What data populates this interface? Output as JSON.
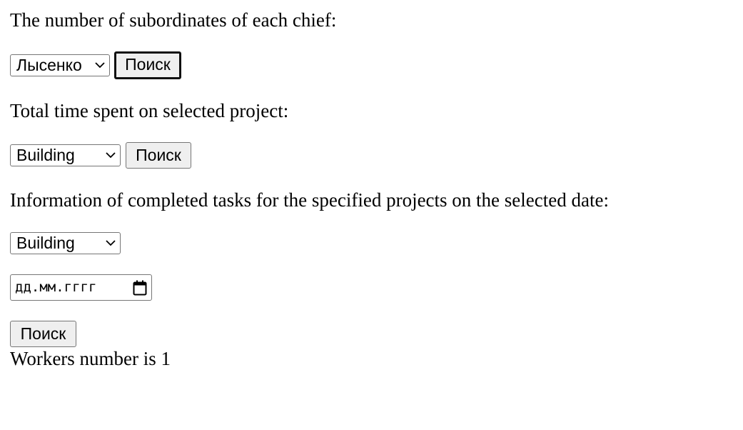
{
  "section_subordinates": {
    "label": "The number of subordinates of each chief:",
    "select_value": "Лысенко",
    "search_button": "Поиск"
  },
  "section_time_spent": {
    "label": "Total time spent on selected project:",
    "select_value": "Building",
    "search_button": "Поиск"
  },
  "section_completed_tasks": {
    "label": "Information of completed tasks for the specified projects on the selected date:",
    "select_value": "Building",
    "date_placeholder": "дд.мм.гггг",
    "search_button": "Поиск"
  },
  "result": {
    "text": "Workers number is 1"
  },
  "icons": {
    "select_arrow": "chevron-down-icon",
    "date_picker": "calendar-icon"
  }
}
